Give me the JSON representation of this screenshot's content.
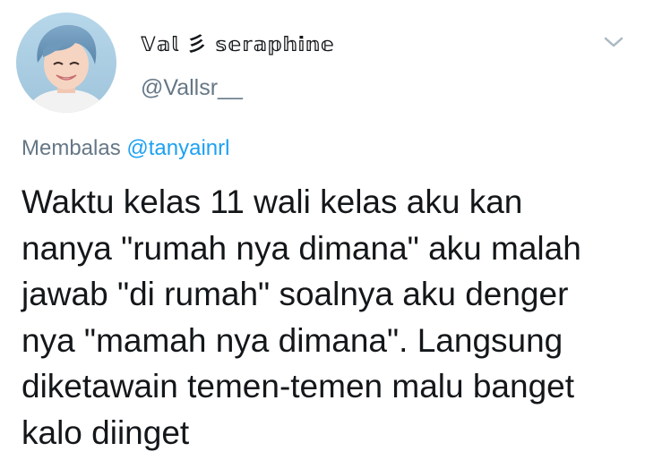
{
  "author": {
    "display_name": "𝕍𝕒𝕝 彡 𝕤𝕖𝕣𝕒𝕡𝕙𝕚𝕟𝕖",
    "handle": "@Vallsr__",
    "avatar_icon": "profile-photo"
  },
  "header": {
    "menu_icon": "chevron-down-icon"
  },
  "reply": {
    "prefix": "Membalas",
    "mention": "@tanyainrl"
  },
  "tweet": {
    "lines": [
      "Waktu kelas 11 wali kelas aku kan",
      "nanya \"rumah nya dimana\" aku malah",
      "jawab \"di rumah\" soalnya aku denger",
      "nya \"mamah nya dimana\". Langsung",
      "diketawain temen-temen malu banget",
      "kalo diinget"
    ]
  },
  "colors": {
    "text_primary": "#14171a",
    "text_secondary": "#657786",
    "link": "#1da1f2",
    "chevron": "#aab8c2"
  }
}
